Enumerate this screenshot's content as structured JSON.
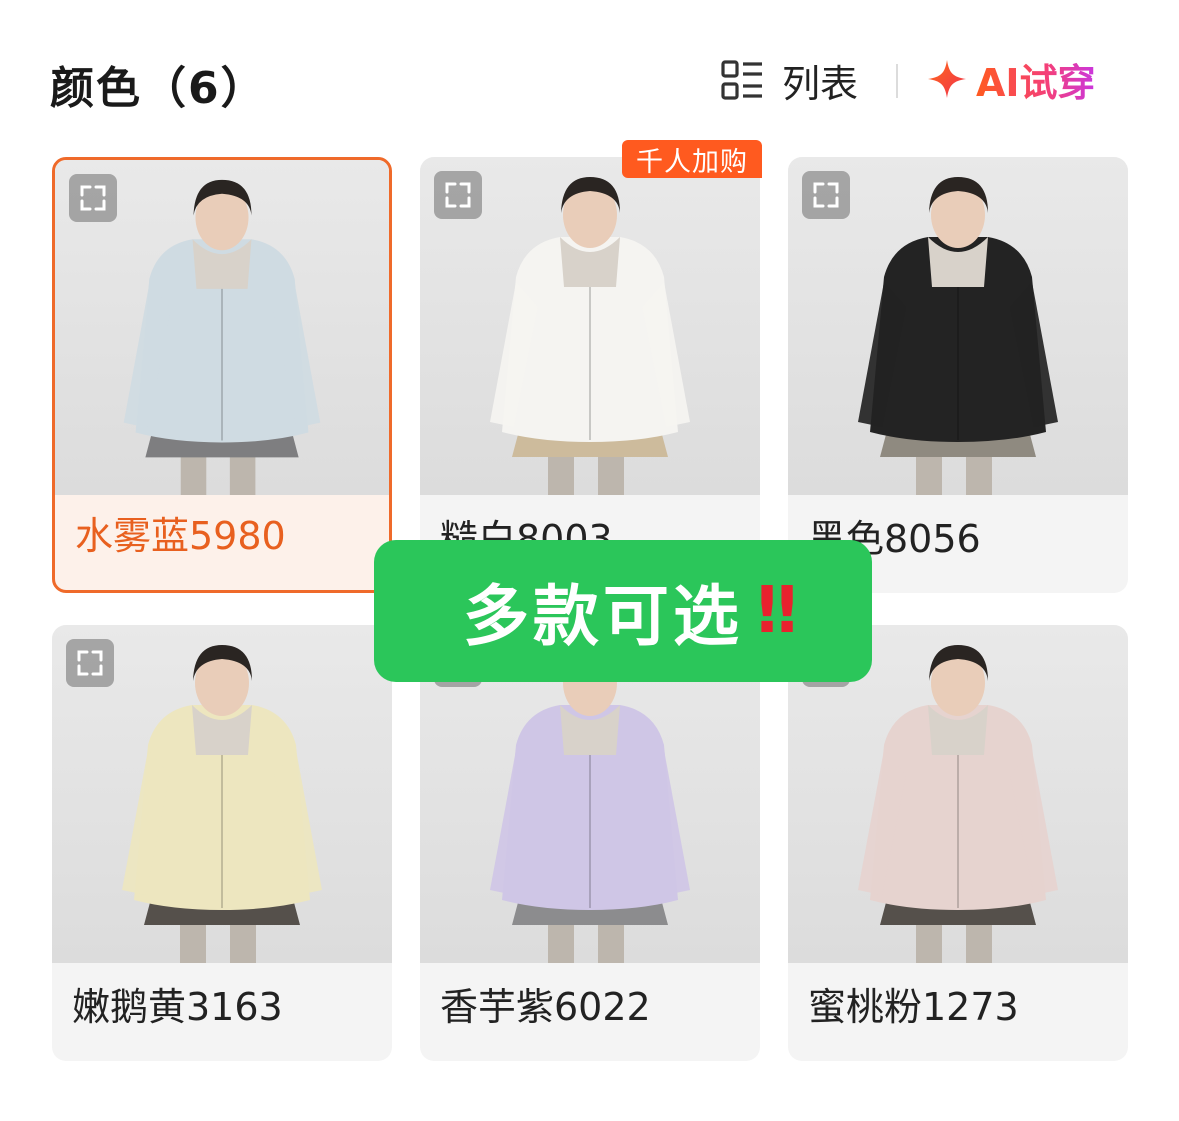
{
  "header": {
    "title": "颜色（6）",
    "list_label": "列表",
    "ai_label": "AI试穿",
    "icons": {
      "list": "list-view-icon",
      "ai": "sparkle-icon"
    }
  },
  "badge": {
    "text": "千人加购"
  },
  "overlay": {
    "text": "多款可选",
    "mark": "‼"
  },
  "colors": {
    "accent": "#ef6a2a",
    "badge_bg": "#ff5a1f",
    "overlay_bg": "#2bc65a",
    "overlay_mark": "#e8222e"
  },
  "items": [
    {
      "label": "水雾蓝5980",
      "selected": true,
      "jacket_color": "#cfdbe2",
      "bottom_color": "#7e7e80"
    },
    {
      "label": "糙白8003",
      "selected": false,
      "jacket_color": "#f5f4f1",
      "bottom_color": "#cdbb9c"
    },
    {
      "label": "黑色8056",
      "selected": false,
      "jacket_color": "#232323",
      "bottom_color": "#8f8a80"
    },
    {
      "label": "嫩鹅黄3163",
      "selected": false,
      "jacket_color": "#ede6bf",
      "bottom_color": "#55504b"
    },
    {
      "label": "香芋紫6022",
      "selected": false,
      "jacket_color": "#cfc6e6",
      "bottom_color": "#8c8c8e"
    },
    {
      "label": "蜜桃粉1273",
      "selected": false,
      "jacket_color": "#e6d3cf",
      "bottom_color": "#55504b"
    }
  ]
}
